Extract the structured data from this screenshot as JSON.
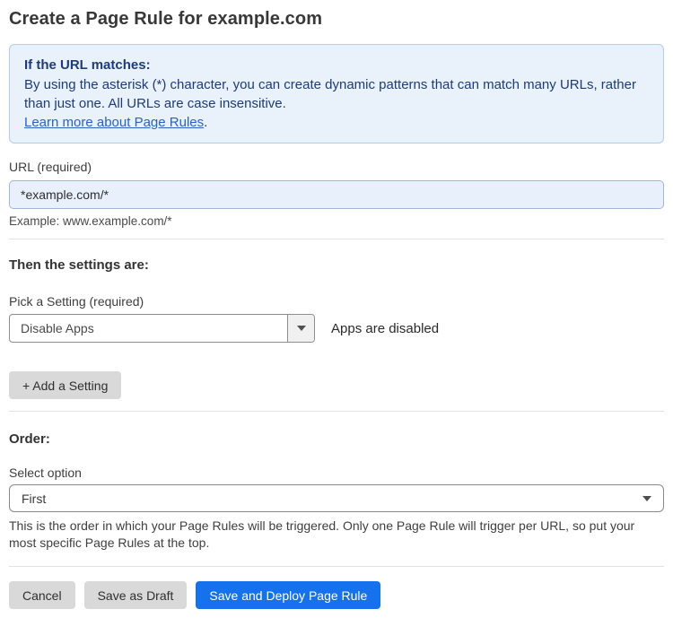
{
  "page": {
    "title": "Create a Page Rule for example.com"
  },
  "info_box": {
    "heading": "If the URL matches:",
    "body": "By using the asterisk (*) character, you can create dynamic patterns that can match many URLs, rather than just one. All URLs are case insensitive.",
    "link_label": "Learn more about Page Rules",
    "link_suffix": "."
  },
  "url_field": {
    "label": "URL (required)",
    "value": "*example.com/*",
    "helper": "Example: www.example.com/*"
  },
  "settings_section": {
    "heading": "Then the settings are:",
    "setting_label": "Pick a Setting (required)",
    "setting_value": "Disable Apps",
    "setting_status": "Apps are disabled",
    "add_setting_label": "+ Add a Setting"
  },
  "order_section": {
    "heading": "Order:",
    "select_label": "Select option",
    "select_value": "First",
    "helper": "This is the order in which your Page Rules will be triggered. Only one Page Rule will trigger per URL, so put your most specific Page Rules at the top."
  },
  "footer": {
    "cancel_label": "Cancel",
    "save_draft_label": "Save as Draft",
    "save_deploy_label": "Save and Deploy Page Rule"
  },
  "colors": {
    "primary_blue": "#1672ec",
    "info_background": "#e9f1fb",
    "info_border": "#b3cdf0",
    "info_text": "#1d3c78",
    "link_blue": "#2b62c9",
    "input_background": "#e8f0fc",
    "gray_button_background": "#d9d9d9"
  }
}
